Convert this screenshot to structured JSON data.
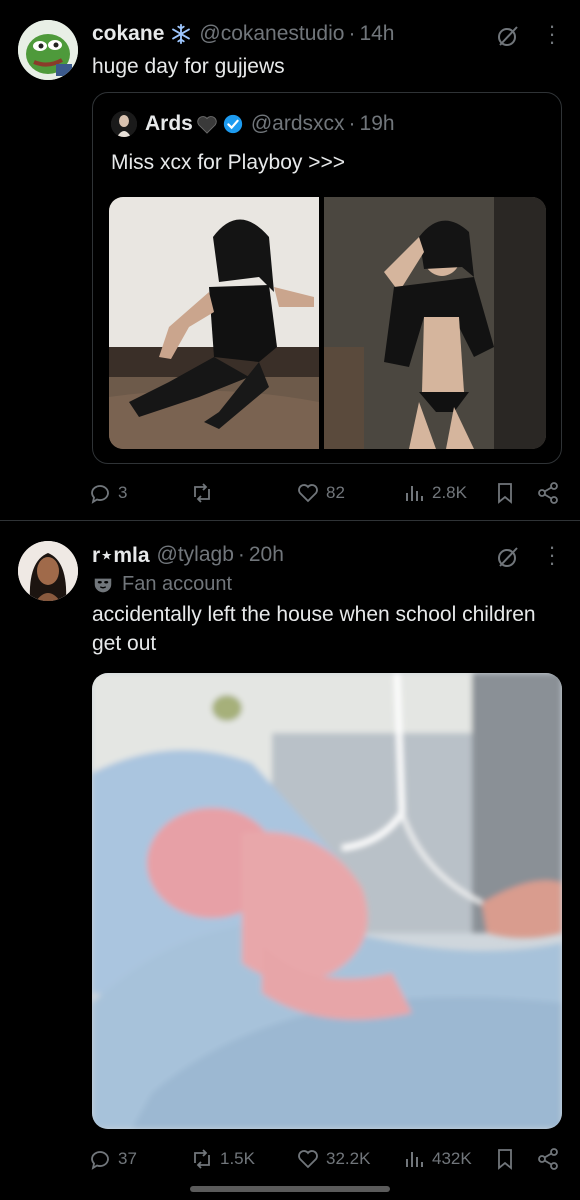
{
  "tweets": [
    {
      "display_name": "cokane",
      "handle": "@cokanestudio",
      "sep": "·",
      "time": "14h",
      "text": "huge day for gujjews",
      "avatar": "pepe-frog-avatar",
      "quote": {
        "display_name": "Ards",
        "handle": "@ardsxcx",
        "sep": "·",
        "time": "19h",
        "text": "Miss xcx for Playboy >>>",
        "verified": true,
        "images": [
          "photo-woman-corset",
          "photo-woman-black-top"
        ]
      },
      "stats": {
        "replies": "3",
        "reposts": "",
        "likes": "82",
        "views": "2.8K"
      }
    },
    {
      "display_name": "r⋆mla",
      "handle": "@tylagb",
      "sep": "·",
      "time": "20h",
      "label": "Fan account",
      "text": "accidentally left the house when school children get out",
      "avatar": "woman-portrait-avatar",
      "media": "photo-hospital-bed",
      "stats": {
        "replies": "37",
        "reposts": "1.5K",
        "likes": "32.2K",
        "views": "432K"
      }
    }
  ],
  "colors": {
    "background": "#000000",
    "text": "#e7e9ea",
    "muted": "#71767b",
    "divider": "#2f3336",
    "verified": "#1d9bf0"
  }
}
